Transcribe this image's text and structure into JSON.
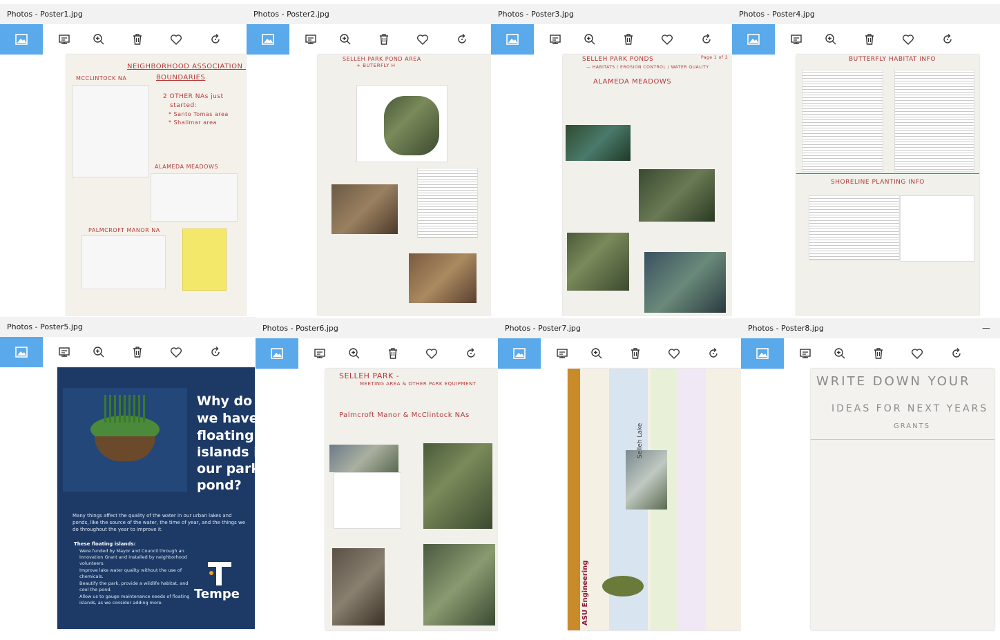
{
  "windows": [
    {
      "title": "Photos - Poster1.jpg"
    },
    {
      "title": "Photos - Poster2.jpg"
    },
    {
      "title": "Photos - Poster3.jpg"
    },
    {
      "title": "Photos - Poster4.jpg"
    },
    {
      "title": "Photos - Poster5.jpg"
    },
    {
      "title": "Photos - Poster6.jpg"
    },
    {
      "title": "Photos - Poster7.jpg"
    },
    {
      "title": "Photos - Poster8.jpg",
      "minimize": "—"
    }
  ],
  "toolbar_icons": [
    "image-icon",
    "slideshow-icon",
    "zoom-in-icon",
    "delete-icon",
    "favorite-icon",
    "rotate-icon"
  ],
  "accent": "#5aa9ea",
  "posters": {
    "p1": {
      "title": "NEIGHBORHOOD ASSOCIATION (NA)",
      "subtitle": "BOUNDARIES",
      "mcclintock": "MCCLINTOCK NA",
      "note1": "2 OTHER NAs just",
      "note2": "started:",
      "note3": "* Santo Tomas area",
      "note4": "* Shalimar area",
      "alameda": "ALAMEDA MEADOWS",
      "palmcroft": "PALMCROFT MANOR NA"
    },
    "p2": {
      "title": "SELLEH PARK POND AREA",
      "subtitle": "+ BUTERFLY H"
    },
    "p3": {
      "title": "SELLEH PARK PONDS",
      "subtitle": "— HABITATS / EROSION CONTROL / WATER QUALITY",
      "page": "Page 1 of 2",
      "alameda": "ALAMEDA MEADOWS"
    },
    "p4": {
      "title": "BUTTERFLY HABITAT INFO",
      "section": "SHORELINE PLANTING INFO"
    },
    "p5": {
      "headline": [
        "Why do",
        "we have",
        "floating",
        "islands in",
        "our park",
        "pond?"
      ],
      "intro": "Many things affect the quality of the water in our urban lakes and ponds, like the source of the water, the time of year, and the things we do throughout the year to improve it.",
      "list_title": "These floating islands:",
      "bullets": [
        "Were funded by Mayor and Council through an Innovation Grant and installed by neighborhood volunteers.",
        "Improve lake water quality without the use of chemicals.",
        "Beautify the park, provide a wildlife habitat, and cool the pond.",
        "Allow us to gauge maintenance needs of floating islands, as we consider adding more."
      ],
      "logo": "Tempe"
    },
    "p6": {
      "title": "SELLEH PARK -",
      "subtitle": "MEETING AREA & OTHER PARK EQUIPMENT",
      "nas": "Palmcroft Manor & McClintock NAs"
    },
    "p7": {
      "engineering": "ASU Engineering",
      "lake": "Selleh Lake"
    },
    "p8": {
      "line1": "WRITE DOWN YOUR",
      "line2": "IDEAS FOR NEXT YEARS",
      "line3": "GRANTS"
    }
  }
}
